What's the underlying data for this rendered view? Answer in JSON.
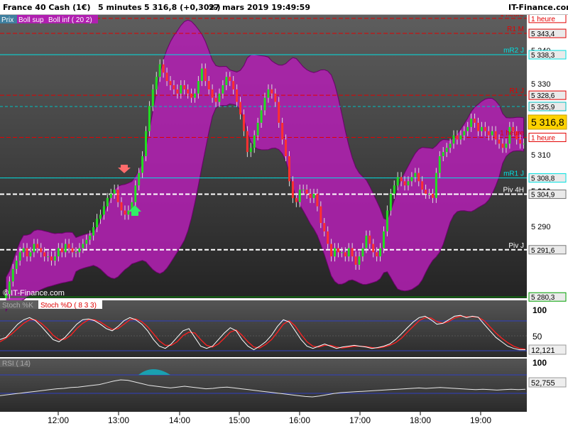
{
  "header": {
    "instrument": "France 40 Cash (1€)",
    "timeframe": "5 minutes",
    "last": "5 316,8 (+0,30%)",
    "datetime": "27 mars 2019 19:49:59",
    "brand": "IT-Finance.com"
  },
  "legend": {
    "prix": "Prix",
    "boll_sup": "Boll sup",
    "boll_inf": "Boll inf ( 20 2)",
    "watermark": "© IT-Finance.com"
  },
  "price_axis": {
    "ticks": [
      "5 340",
      "5 330",
      "5 310",
      "5 300",
      "5 290"
    ],
    "current_price": "5 316,8"
  },
  "levels": [
    {
      "label": "1 heure",
      "value": "",
      "color": "#e30000"
    },
    {
      "label": "R1 M",
      "value": "5 343,4",
      "color": "#e30000"
    },
    {
      "label": "mR2 J",
      "value": "5 338,3",
      "color": "#00e0e0"
    },
    {
      "label": "R1 J",
      "value": "5 328,6",
      "color": "#e30000"
    },
    {
      "label": "",
      "value": "5 325,9",
      "color": "#00c0c0"
    },
    {
      "label": "1 heure",
      "value": "",
      "color": "#e30000"
    },
    {
      "label": "mR1 J",
      "value": "5 308,8",
      "color": "#00e0e0"
    },
    {
      "label": "Piv 4H",
      "value": "5 304,9",
      "color": "#ffffff"
    },
    {
      "label": "",
      "value": "5 304,9",
      "color": "#ffffff"
    },
    {
      "label": "Piv J",
      "value": "5 291,6",
      "color": "#ffffff"
    },
    {
      "label": "",
      "value": "5 280,3",
      "color": "#00a000"
    }
  ],
  "stoch": {
    "label_k": "Stoch %K",
    "label_d": "Stoch %D ( 8 3 3)",
    "ticks": [
      "100",
      "50"
    ],
    "last": "12,121"
  },
  "rsi": {
    "label": "RSI ( 14)",
    "ticks": [
      "100"
    ],
    "last": "52,755"
  },
  "time_axis": [
    "12:00",
    "13:00",
    "14:00",
    "15:00",
    "16:00",
    "17:00",
    "18:00",
    "19:00"
  ],
  "colors": {
    "bull": "#22dd22",
    "bear": "#ff3030",
    "band": "#b020b0",
    "stoch_k": "#ffffff",
    "stoch_d": "#ff2020"
  },
  "chart_data": {
    "type": "candlestick",
    "title": "France 40 Cash (1€) 5 minutes",
    "ylim": [
      5280,
      5348
    ],
    "close": [
      5281,
      5284,
      5287,
      5289,
      5291,
      5292,
      5290,
      5291,
      5293,
      5292,
      5291,
      5290,
      5290,
      5289,
      5290,
      5292,
      5291,
      5293,
      5292,
      5291,
      5291,
      5292,
      5293,
      5294,
      5295,
      5297,
      5299,
      5300,
      5302,
      5304,
      5305,
      5306,
      5303,
      5301,
      5300,
      5301,
      5303,
      5307,
      5310,
      5314,
      5320,
      5326,
      5330,
      5333,
      5336,
      5334,
      5332,
      5331,
      5330,
      5329,
      5331,
      5330,
      5329,
      5328,
      5329,
      5332,
      5335,
      5332,
      5330,
      5328,
      5327,
      5329,
      5331,
      5333,
      5332,
      5330,
      5327,
      5324,
      5320,
      5315,
      5316,
      5319,
      5322,
      5325,
      5328,
      5330,
      5329,
      5327,
      5322,
      5318,
      5314,
      5308,
      5304,
      5303,
      5306,
      5306,
      5305,
      5304,
      5305,
      5302,
      5298,
      5296,
      5293,
      5290,
      5292,
      5291,
      5291,
      5290,
      5292,
      5290,
      5288,
      5290,
      5292,
      5295,
      5293,
      5291,
      5290,
      5292,
      5296,
      5301,
      5305,
      5307,
      5309,
      5308,
      5307,
      5308,
      5309,
      5310,
      5308,
      5306,
      5305,
      5305,
      5304,
      5310,
      5314,
      5315,
      5316,
      5317,
      5319,
      5318,
      5319,
      5320,
      5321,
      5323,
      5322,
      5320,
      5321,
      5320,
      5319,
      5320,
      5318,
      5317,
      5316,
      5317,
      5321,
      5320,
      5318,
      5317,
      5317
    ],
    "bollinger": "Boll sup / Boll inf ( 20 2)",
    "stoch_k": [
      35,
      40,
      55,
      70,
      80,
      85,
      78,
      65,
      50,
      35,
      30,
      40,
      55,
      70,
      80,
      82,
      78,
      70,
      60,
      55,
      65,
      78,
      85,
      80,
      70,
      55,
      35,
      20,
      15,
      25,
      40,
      55,
      60,
      40,
      20,
      15,
      20,
      35,
      50,
      62,
      55,
      35,
      20,
      12,
      20,
      30,
      45,
      65,
      80,
      75,
      55,
      35,
      20,
      15,
      20,
      25,
      20,
      15,
      18,
      20,
      22,
      20,
      18,
      15,
      17,
      20,
      25,
      35,
      48,
      62,
      75,
      85,
      88,
      80,
      70,
      72,
      80,
      88,
      90,
      85,
      88,
      86,
      70,
      55,
      40,
      30,
      20,
      15,
      12,
      12
    ],
    "stoch_d": [
      30,
      38,
      48,
      60,
      72,
      80,
      80,
      72,
      60,
      45,
      35,
      36,
      45,
      60,
      72,
      80,
      80,
      75,
      66,
      58,
      60,
      70,
      80,
      82,
      76,
      64,
      48,
      32,
      22,
      22,
      30,
      44,
      52,
      50,
      35,
      22,
      18,
      25,
      38,
      52,
      57,
      45,
      30,
      18,
      16,
      24,
      35,
      52,
      70,
      78,
      66,
      47,
      30,
      20,
      18,
      22,
      22,
      18,
      16,
      18,
      20,
      20,
      19,
      17,
      16,
      18,
      22,
      28,
      38,
      52,
      65,
      78,
      85,
      84,
      76,
      72,
      76,
      84,
      88,
      87,
      87,
      86,
      78,
      64,
      50,
      38,
      28,
      20,
      15,
      13
    ],
    "rsi": [
      38,
      40,
      42,
      44,
      46,
      48,
      50,
      52,
      54,
      55,
      57,
      58,
      60,
      62,
      64,
      68,
      72,
      75,
      74,
      70,
      66,
      62,
      60,
      58,
      56,
      58,
      60,
      58,
      56,
      54,
      55,
      57,
      58,
      56,
      54,
      52,
      50,
      48,
      46,
      44,
      42,
      40,
      38,
      36,
      35,
      37,
      40,
      43,
      45,
      46,
      47,
      48,
      49,
      50,
      51,
      52,
      53,
      54,
      55,
      56,
      55,
      56,
      57,
      56,
      55,
      54,
      53,
      52,
      53,
      52,
      51,
      52,
      53,
      52,
      53
    ]
  }
}
